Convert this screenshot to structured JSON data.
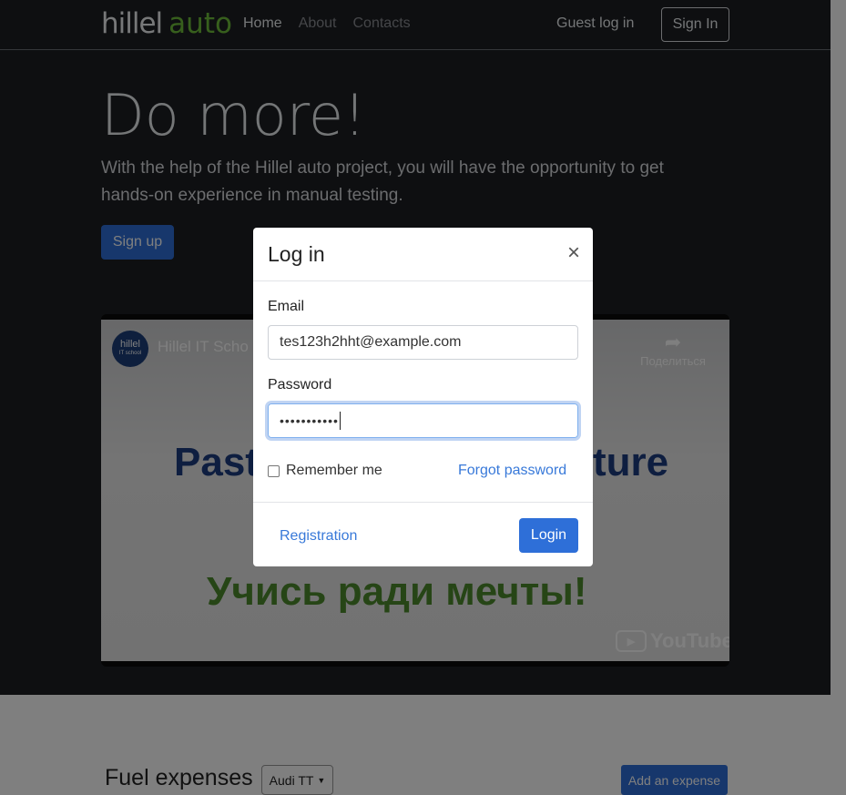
{
  "navbar": {
    "logo_main": "hillel",
    "logo_accent": "auto",
    "links": [
      "Home",
      "About",
      "Contacts"
    ],
    "guest_login": "Guest log in",
    "sign_in": "Sign In"
  },
  "hero": {
    "title": "Do more!",
    "description": "With the help of the Hillel auto project, you will have the opportunity to get hands-on experience in manual testing.",
    "signup_label": "Sign up"
  },
  "video": {
    "channel_avatar_line1": "hillel",
    "channel_avatar_line2": "IT school",
    "title": "Hillel IT Scho",
    "share_label": "Поделиться",
    "text_line1_left": "Past",
    "text_line1_right": "ture",
    "text_line2": "Учись ради мечты!",
    "brand": "YouTube"
  },
  "fuel": {
    "heading": "Fuel expenses",
    "car_selected": "Audi TT",
    "add_label": "Add an expense"
  },
  "modal": {
    "title": "Log in",
    "close_glyph": "×",
    "email_label": "Email",
    "email_value": "tes123h2hht@example.com",
    "password_label": "Password",
    "password_mask": "•••••••••••",
    "remember_label": "Remember me",
    "forgot_label": "Forgot password",
    "registration_label": "Registration",
    "login_label": "Login"
  },
  "colors": {
    "primary": "#2e6fd8",
    "link": "#3879d9",
    "hero_bg": "#1d1f22",
    "logo_accent": "#6fbf3a"
  }
}
